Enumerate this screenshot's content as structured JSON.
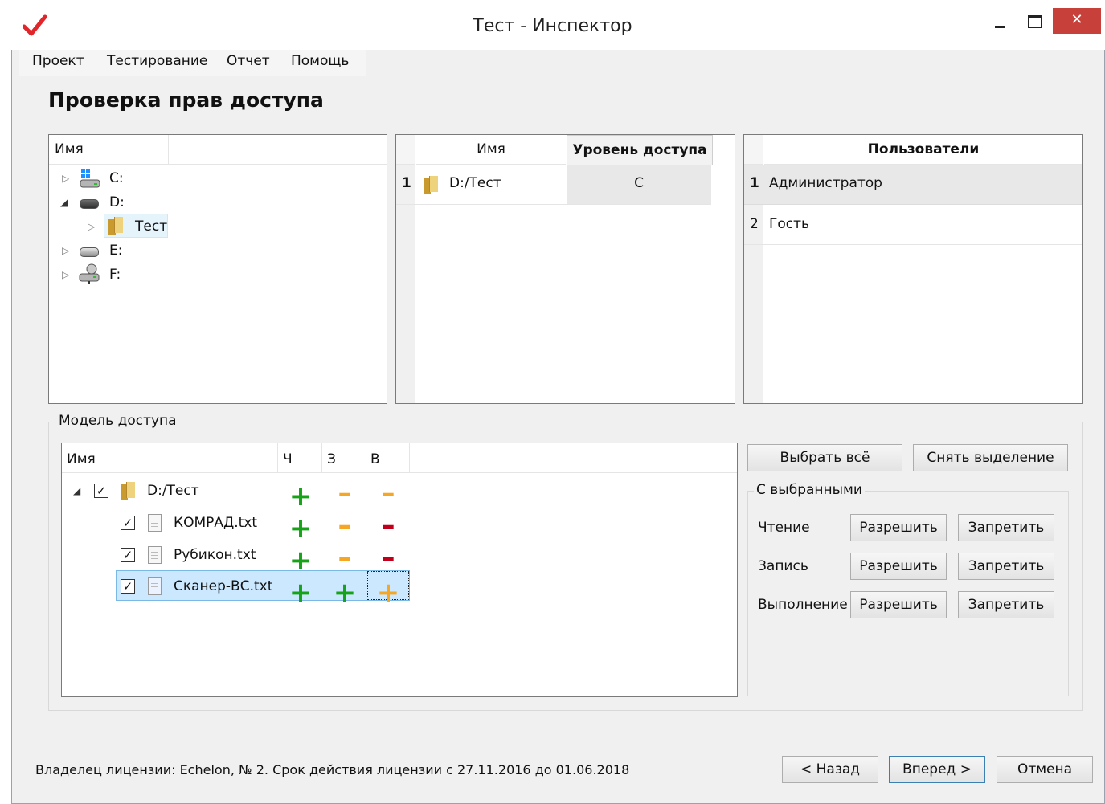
{
  "window": {
    "title": "Тест - Инспектор",
    "close_symbol": "✕",
    "logo_icon": "red-checkmark-icon",
    "accent_color": "#c7413a"
  },
  "menu": {
    "items": [
      "Проект",
      "Тестирование",
      "Отчет",
      "Помощь"
    ]
  },
  "page_title": "Проверка прав доступа",
  "tree_panel": {
    "header": "Имя",
    "nodes": [
      {
        "label": "C:",
        "icon": "windows-drive-icon",
        "expanded": false
      },
      {
        "label": "D:",
        "icon": "drive-icon",
        "expanded": true
      },
      {
        "label": "Тест",
        "icon": "folder-icon",
        "expanded": false,
        "selected": true
      },
      {
        "label": "E:",
        "icon": "drive-icon",
        "expanded": false
      },
      {
        "label": "F:",
        "icon": "network-drive-icon",
        "expanded": false
      }
    ]
  },
  "objects_panel": {
    "columns": [
      "Имя",
      "Уровень доступа"
    ],
    "rows": [
      {
        "num": "1",
        "name": "D:/Тест",
        "level": "С"
      }
    ]
  },
  "users_panel": {
    "header": "Пользователи",
    "rows": [
      {
        "num": "1",
        "name": "Администратор"
      },
      {
        "num": "2",
        "name": "Гость"
      }
    ]
  },
  "access_model": {
    "group_label": "Модель доступа",
    "columns": [
      "Имя",
      "Ч",
      "З",
      "В"
    ],
    "rows": [
      {
        "name": "D:/Тест",
        "icon": "folder-icon",
        "checked": true,
        "read": "+",
        "write": "-",
        "exec": "-"
      },
      {
        "name": "КОМРАД.txt",
        "icon": "file-icon",
        "checked": true,
        "read": "+",
        "write": "-",
        "exec": "-"
      },
      {
        "name": "Рубикон.txt",
        "icon": "file-icon",
        "checked": true,
        "read": "+",
        "write": "-",
        "exec": "-"
      },
      {
        "name": "Сканер-ВС.txt",
        "icon": "file-icon",
        "checked": true,
        "read": "+",
        "write": "+",
        "exec": "+"
      }
    ],
    "check_mark": "✓",
    "select_all_label": "Выбрать всё",
    "deselect_label": "Снять выделение",
    "with_selected": {
      "label": "С выбранными",
      "rows": [
        {
          "label": "Чтение",
          "allow": "Разрешить",
          "deny": "Запретить"
        },
        {
          "label": "Запись",
          "allow": "Разрешить",
          "deny": "Запретить"
        },
        {
          "label": "Выполнение",
          "allow": "Разрешить",
          "deny": "Запретить"
        }
      ]
    }
  },
  "footer": {
    "license_text": "Владелец лицензии: Echelon, № 2. Срок действия лицензии с 27.11.2016 до 01.06.2018",
    "back_label": "< Назад",
    "next_label": "Вперед >",
    "cancel_label": "Отмена"
  },
  "colors": {
    "allow_green": "#17a317",
    "partial_yellow": "#f5a623",
    "deny_red": "#c0001a",
    "selection_blue": "#cce8ff"
  }
}
